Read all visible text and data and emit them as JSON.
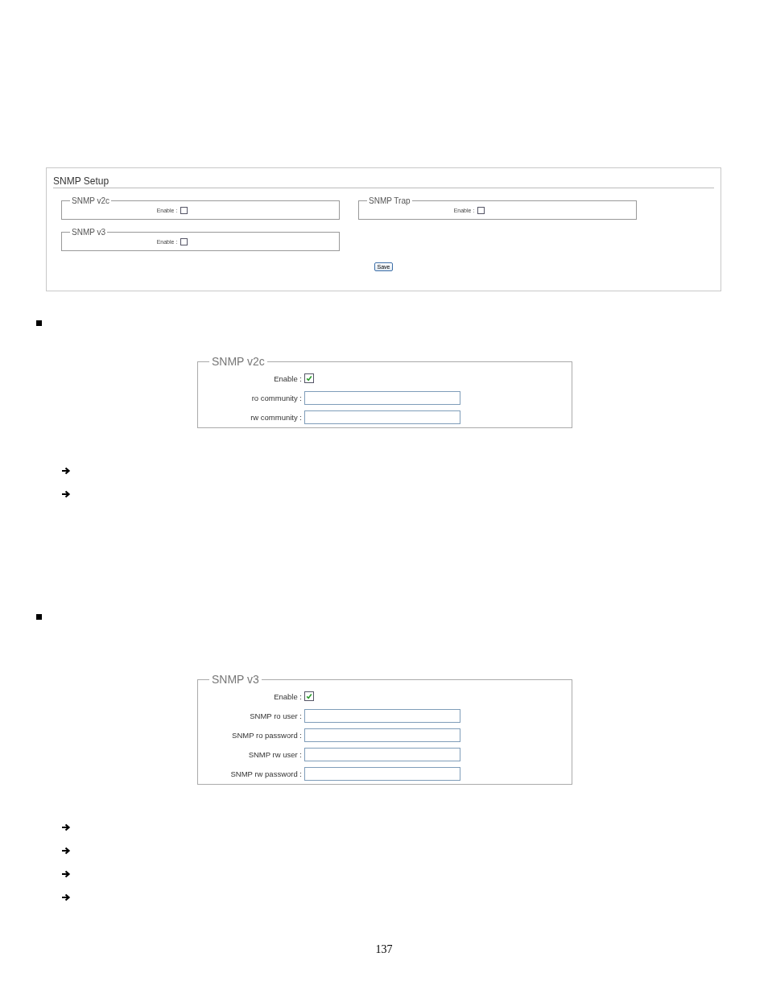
{
  "setup_panel": {
    "title": "SNMP Setup",
    "groups": [
      {
        "title": "SNMP v2c",
        "enable_label": "Enable :",
        "enabled": false
      },
      {
        "title": "SNMP Trap",
        "enable_label": "Enable :",
        "enabled": false
      },
      {
        "title": "SNMP v3",
        "enable_label": "Enable :",
        "enabled": false
      }
    ],
    "save_button": "Save"
  },
  "sections": [
    {
      "title": "SNMP v2c",
      "enable_label": "Enable :",
      "enabled": true,
      "fields": [
        {
          "label": "ro community :"
        },
        {
          "label": "rw community :"
        }
      ],
      "notes": [
        {
          "kind": "arrow"
        },
        {
          "kind": "arrow"
        }
      ]
    },
    {
      "title": "SNMP v3",
      "enable_label": "Enable :",
      "enabled": true,
      "fields": [
        {
          "label": "SNMP ro user :"
        },
        {
          "label": "SNMP ro password :"
        },
        {
          "label": "SNMP rw user :"
        },
        {
          "label": "SNMP rw password :"
        }
      ],
      "notes": [
        {
          "kind": "arrow"
        },
        {
          "kind": "arrow"
        },
        {
          "kind": "arrow"
        },
        {
          "kind": "arrow"
        }
      ]
    }
  ],
  "page_number": "137"
}
